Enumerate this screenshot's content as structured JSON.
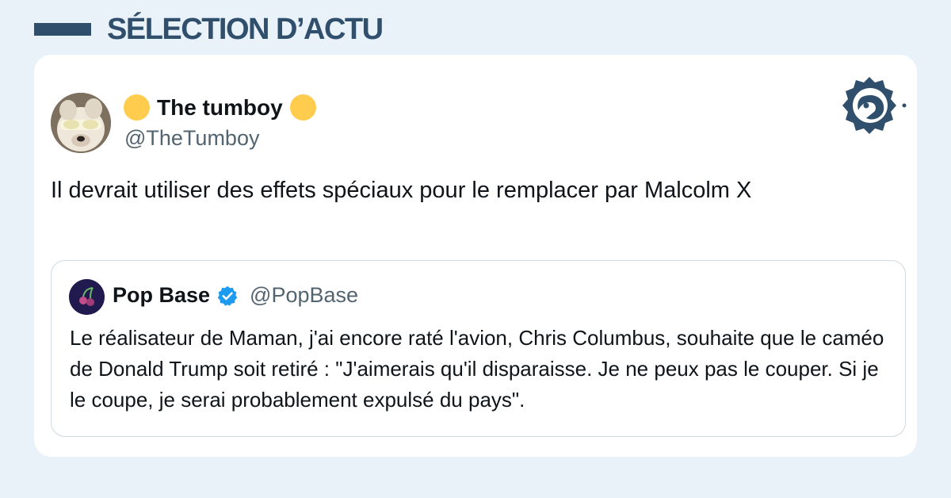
{
  "header": {
    "title": "SÉLECTION D’ACTU"
  },
  "tweet": {
    "display_name": "The tumboy",
    "name_emoji_icon": "yellow-circle-icon",
    "handle": "@TheTumboy",
    "text": "Il devrait utiliser des effets spéciaux pour le remplacer par Malcolm X"
  },
  "quoted_tweet": {
    "display_name": "Pop Base",
    "verified_icon": "verified-badge-icon",
    "handle": "@PopBase",
    "text": "Le réalisateur de Maman, j'ai encore raté l'avion, Chris Columbus, souhaite que le caméo de Donald Trump soit retiré : \"J'aimerais qu'il disparaisse. Je ne peux pas le couper. Si je le coupe, je serai probablement expulsé du pays\"."
  },
  "brand": {
    "logo_icon": "chick-logo-icon"
  },
  "colors": {
    "background": "#e9f1f9",
    "accent": "#2f4f6c",
    "card": "#ffffff",
    "verified": "#1d9bf0",
    "emoji": "#ffcc4d"
  }
}
